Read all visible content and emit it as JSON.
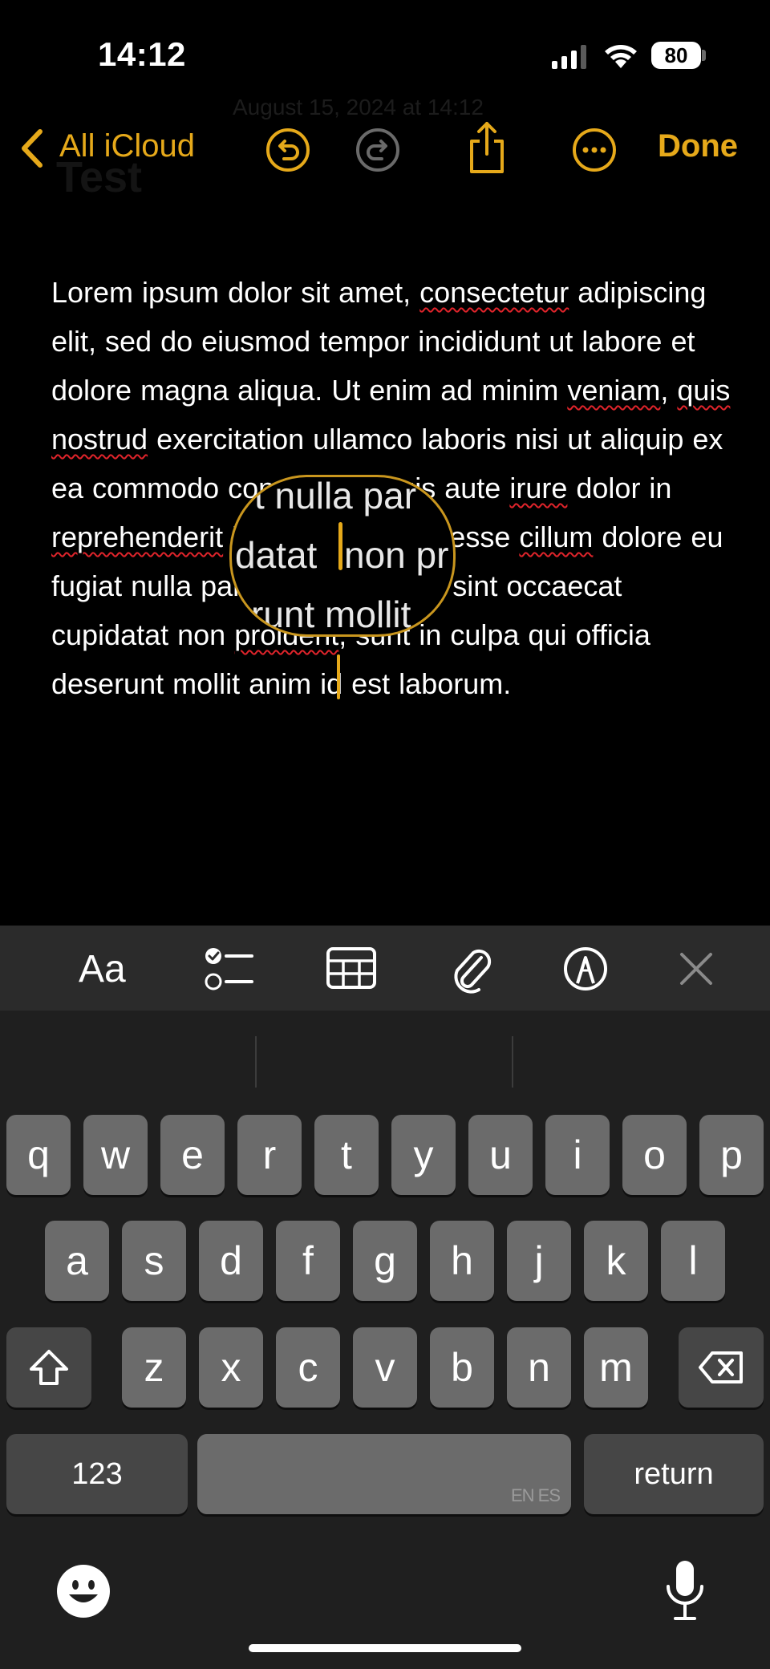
{
  "status_bar": {
    "time": "14:12",
    "battery": "80"
  },
  "nav": {
    "back_label": "All iCloud",
    "done_label": "Done",
    "faded_date": "August 15, 2024 at 14:12",
    "faded_title": "Test"
  },
  "note": {
    "segments": [
      {
        "t": "Lorem ipsum dolor sit amet, "
      },
      {
        "t": "consectetur",
        "spell": true
      },
      {
        "t": " adipiscing elit, sed do eiusmod tempor incididunt ut labore et dolore magna aliqua. Ut enim ad minim "
      },
      {
        "t": "veniam",
        "spell": true
      },
      {
        "t": ", "
      },
      {
        "t": "quis",
        "spell": true
      },
      {
        "t": " "
      },
      {
        "t": "nostrud",
        "spell": true
      },
      {
        "t": " exercitation ullamco laboris nisi ut aliquip ex ea commodo consequat. Duis aute "
      },
      {
        "t": "irure",
        "spell": true
      },
      {
        "t": " dolor in "
      },
      {
        "t": "reprehenderit",
        "spell": true
      },
      {
        "t": " in voluptate velit esse "
      },
      {
        "t": "cillum",
        "spell": true
      },
      {
        "t": " dolore eu fugiat nulla pariatur. Excepteur sint occaecat cupidatat non "
      },
      {
        "t": "proident",
        "spell": true
      },
      {
        "t": ", sunt in culpa qui officia deserunt mollit anim id est laborum."
      }
    ]
  },
  "loupe": {
    "line1": "t nulla par",
    "line2_left": "datat ",
    "line2_right": "non pr",
    "line3": "runt mollit"
  },
  "toolbar": {
    "format_label": "Aa"
  },
  "keyboard": {
    "row1": [
      "q",
      "w",
      "e",
      "r",
      "t",
      "y",
      "u",
      "i",
      "o",
      "p"
    ],
    "row2": [
      "a",
      "s",
      "d",
      "f",
      "g",
      "h",
      "j",
      "k",
      "l"
    ],
    "row3": [
      "z",
      "x",
      "c",
      "v",
      "b",
      "n",
      "m"
    ],
    "numbers_label": "123",
    "space_lang": "EN ES",
    "return_label": "return"
  },
  "colors": {
    "accent": "#E6A91A",
    "background": "#000000",
    "keyboard_bg": "#1f1f1f",
    "key": "#6b6b6b",
    "key_dark": "#464646"
  },
  "icons": [
    "cellular-icon",
    "wifi-icon",
    "back-chevron-icon",
    "undo-icon",
    "redo-icon",
    "share-icon",
    "more-icon",
    "checklist-icon",
    "table-icon",
    "attachment-icon",
    "markup-icon",
    "close-icon",
    "shift-icon",
    "delete-icon",
    "emoji-icon",
    "microphone-icon"
  ]
}
